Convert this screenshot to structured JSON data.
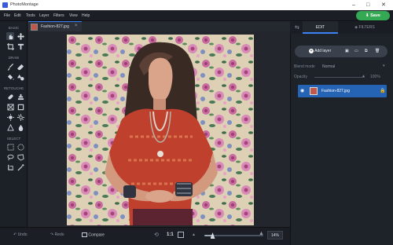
{
  "app": {
    "title": "PhotoMontage"
  },
  "menu": {
    "items": [
      "File",
      "Edit",
      "Tools",
      "Layer",
      "Filters",
      "View",
      "Help"
    ]
  },
  "toolbar": {
    "save_label": "Save"
  },
  "tools": {
    "sections": [
      "BASIC",
      "DRAW",
      "RETOUCHE",
      "SELECT"
    ]
  },
  "document": {
    "tab_name": "Fashion-827.jpg"
  },
  "bottom": {
    "undo_label": "Undo",
    "redo_label": "Redo",
    "compare_label": "Compare",
    "ratio_label": "1:1",
    "zoom_value": "14%",
    "zoom_level": 0.14
  },
  "right_panel": {
    "tabs": [
      "EDIT",
      "FILTERS"
    ],
    "active_tab": "EDIT",
    "add_layer_label": "Add layer",
    "blend_mode_label": "Blend mode",
    "blend_mode_value": "Normal",
    "opacity_label": "Opacity",
    "opacity_value": "100%",
    "layers": [
      {
        "name": "Fashion-827.jpg",
        "locked": true,
        "visible": true
      }
    ]
  },
  "colors": {
    "accent": "#34a853",
    "selection": "#2563b5",
    "tab_accent": "#3b82f6"
  }
}
